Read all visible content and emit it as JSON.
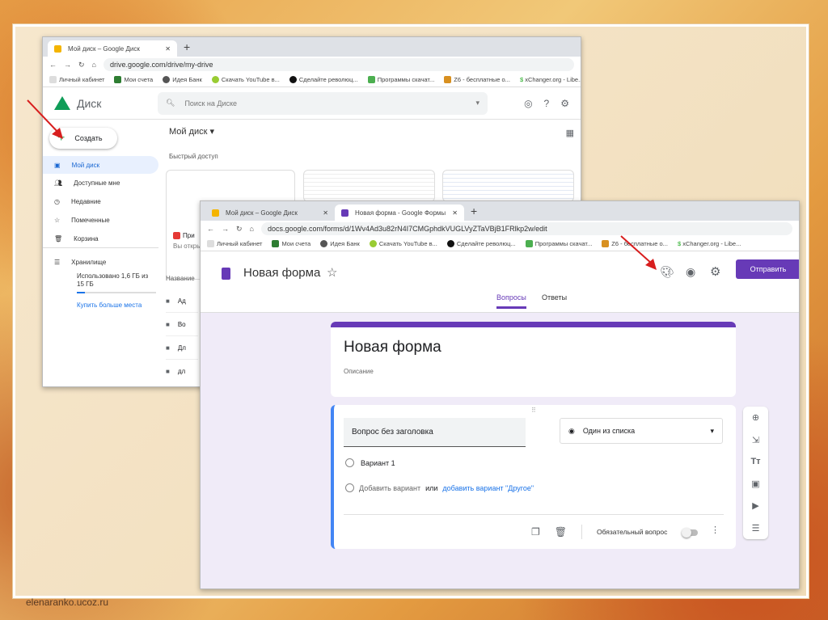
{
  "site": "elenaranko.ucoz.ru",
  "bookmarks": [
    "Личный кабинет",
    "Мои счета",
    "Идея Банк",
    "Скачать YouTube в...",
    "Сделайте революц...",
    "Программы скачат...",
    "Z6 - бесплатные о...",
    "xChanger.org - Libe..."
  ],
  "drive": {
    "tab_title": "Мой диск – Google Диск",
    "url": "drive.google.com/drive/my-drive",
    "logo": "Диск",
    "search_placeholder": "Поиск на Диске",
    "create": "Создать",
    "nav": [
      "Мой диск",
      "Доступные мне",
      "Недавние",
      "Помеченные",
      "Корзина"
    ],
    "storage_label": "Хранилище",
    "storage_text": "Использовано 1,6 ГБ из 15 ГБ",
    "storage_fraction": 0.1,
    "buy": "Купить больше места",
    "heading": "Мой диск",
    "quick": "Быстрый доступ",
    "file_name": "При",
    "file_sub": "Вы откры",
    "col_name": "Название",
    "folders": [
      "Ад",
      "Во",
      "Дл",
      "дл"
    ]
  },
  "forms": {
    "tab1": "Мой диск – Google Диск",
    "tab2": "Новая форма - Google Формы",
    "url": "docs.google.com/forms/d/1Wv4Ad3u82rN4I7CMGphdkVUGLVyZTaVBjB1FRlkp2w/edit",
    "title": "Новая форма",
    "send": "Отправить",
    "tabs": [
      "Вопросы",
      "Ответы"
    ],
    "form_title": "Новая форма",
    "description": "Описание",
    "question": "Вопрос без заголовка",
    "type": "Один из списка",
    "option1": "Вариант 1",
    "add_option": "Добавить вариант",
    "or": "или",
    "add_other": "добавить вариант \"Другое\"",
    "required": "Обязательный вопрос",
    "accent": "#673ab7"
  }
}
